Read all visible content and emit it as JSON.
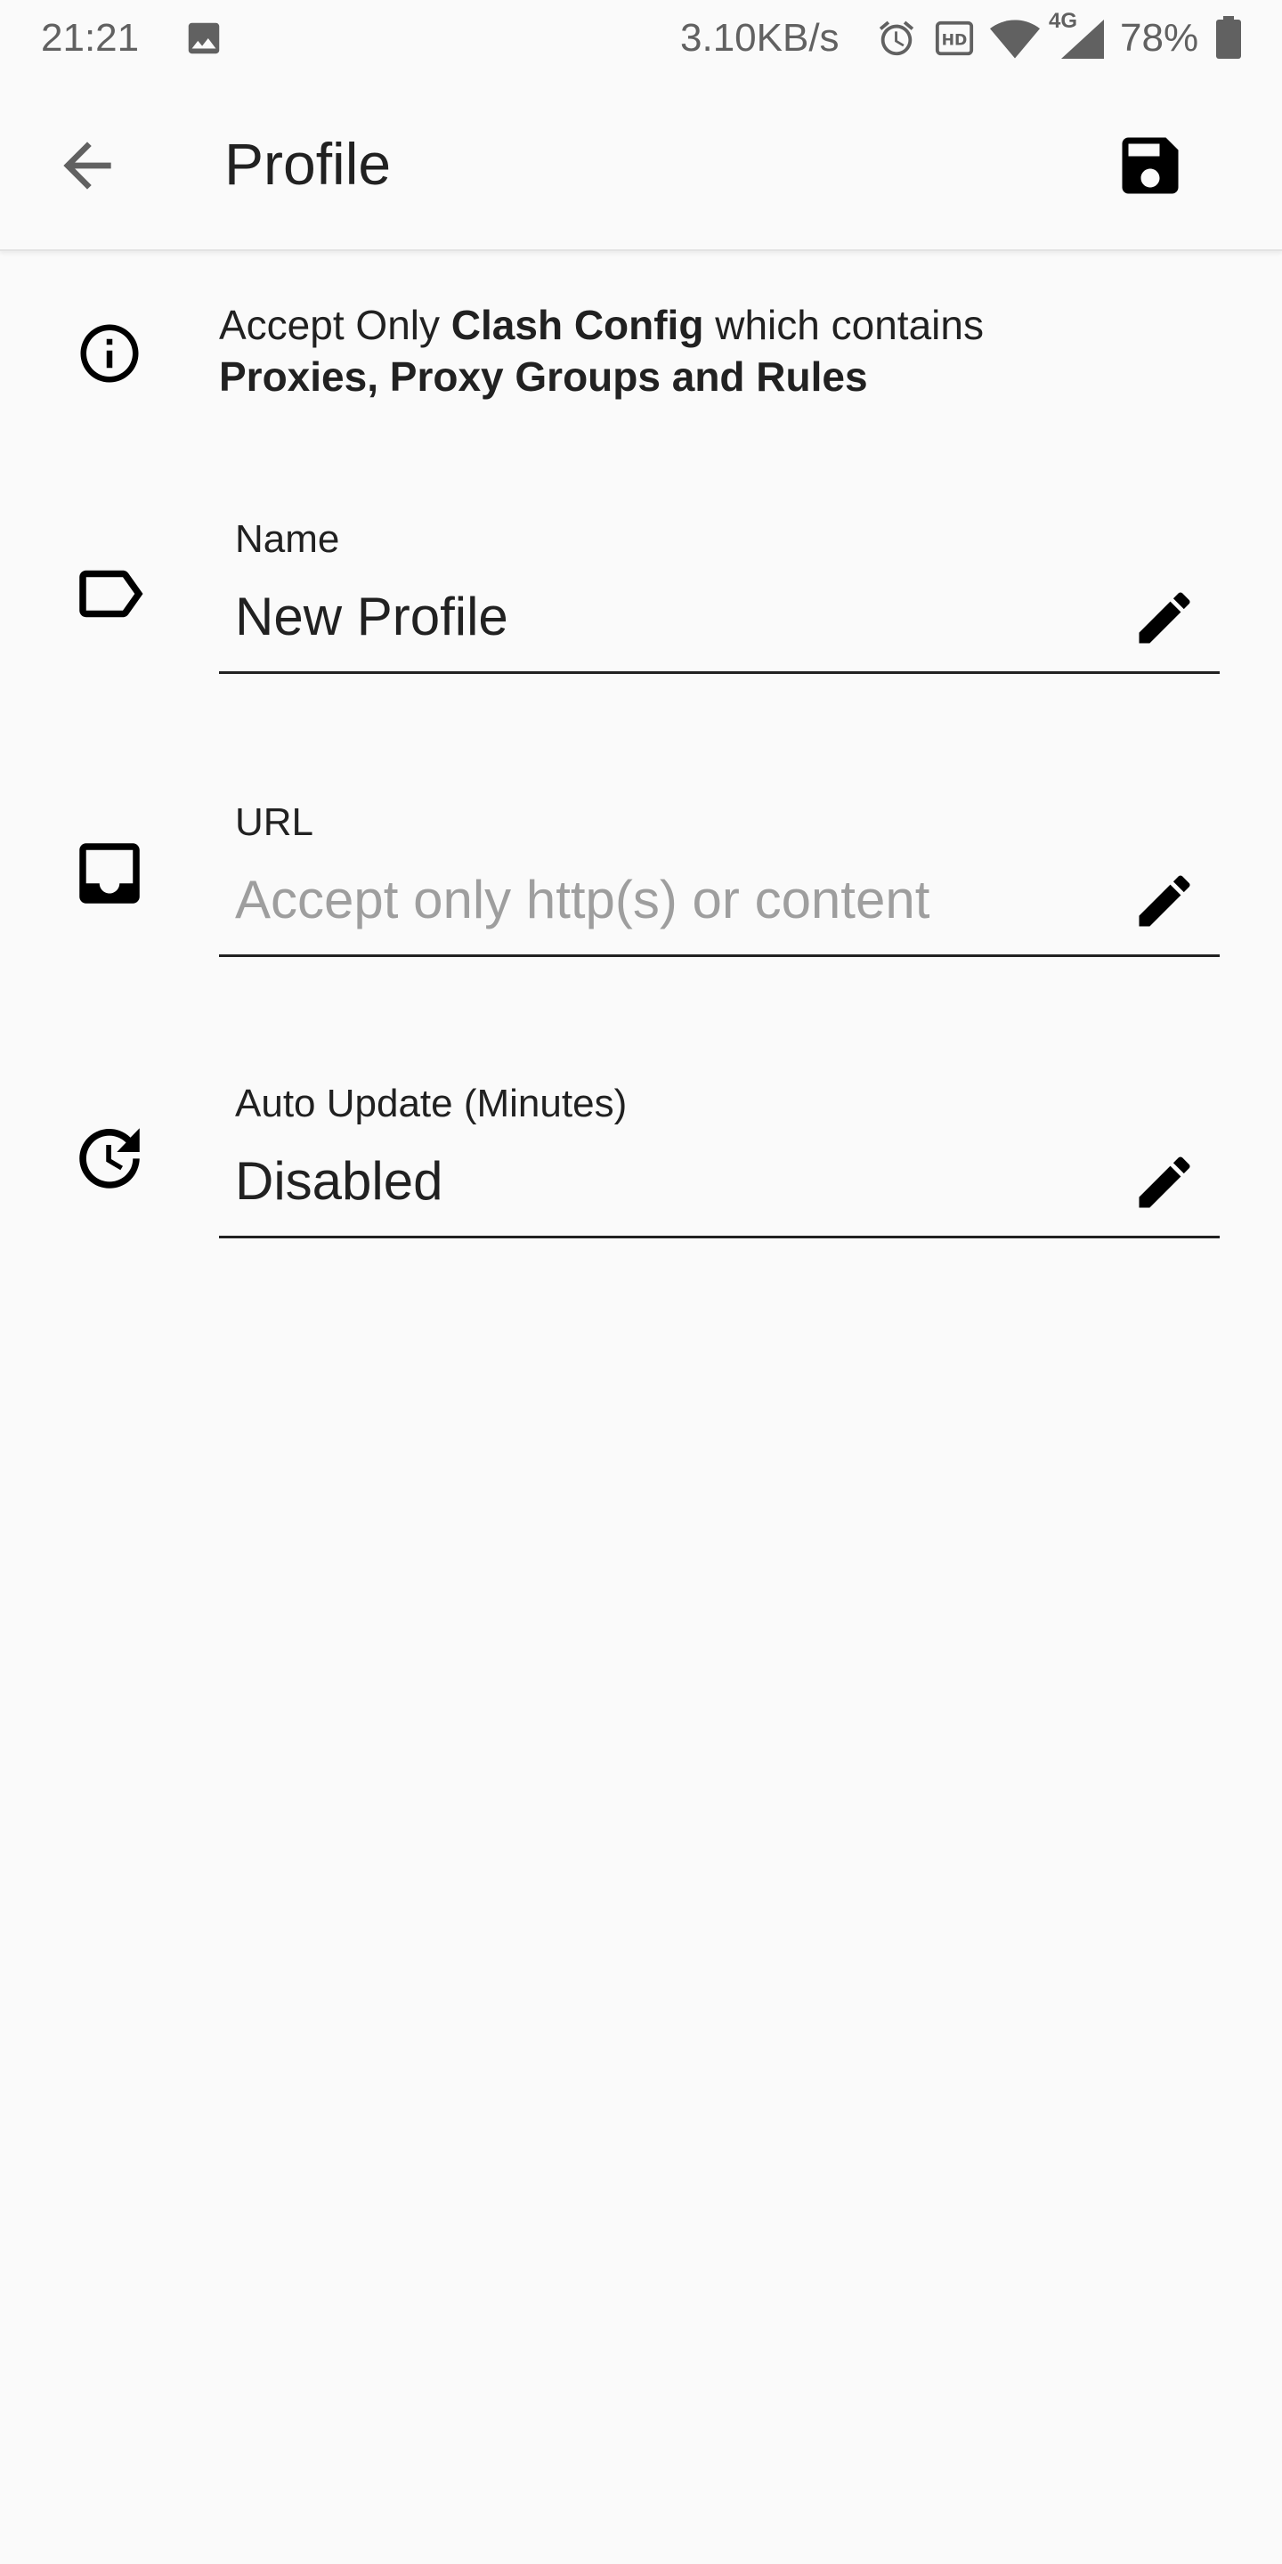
{
  "status_bar": {
    "time": "21:21",
    "network_speed": "3.10KB/s",
    "network_type": "4G",
    "battery": "78%",
    "icons": [
      "image-icon",
      "alarm-icon",
      "hd-icon",
      "wifi-icon",
      "signal-icon",
      "battery-icon"
    ]
  },
  "app_bar": {
    "title": "Profile",
    "back_icon": "arrow-back-icon",
    "save_icon": "save-icon"
  },
  "tip": {
    "prefix": "Accept Only ",
    "bold1": "Clash Config",
    "middle": " which contains",
    "bold2": "Proxies, Proxy Groups and Rules",
    "icon": "info-icon"
  },
  "fields": {
    "name": {
      "label": "Name",
      "value": "New Profile",
      "icon": "label-icon"
    },
    "url": {
      "label": "URL",
      "placeholder": "Accept only http(s) or content",
      "value": "",
      "icon": "inbox-icon"
    },
    "auto_update": {
      "label": "Auto Update (Minutes)",
      "value": "Disabled",
      "icon": "update-clock-icon"
    }
  },
  "colors": {
    "background": "#fafafa",
    "text_primary": "#212121",
    "text_hint": "#9e9e9e",
    "status_text": "#616161"
  }
}
